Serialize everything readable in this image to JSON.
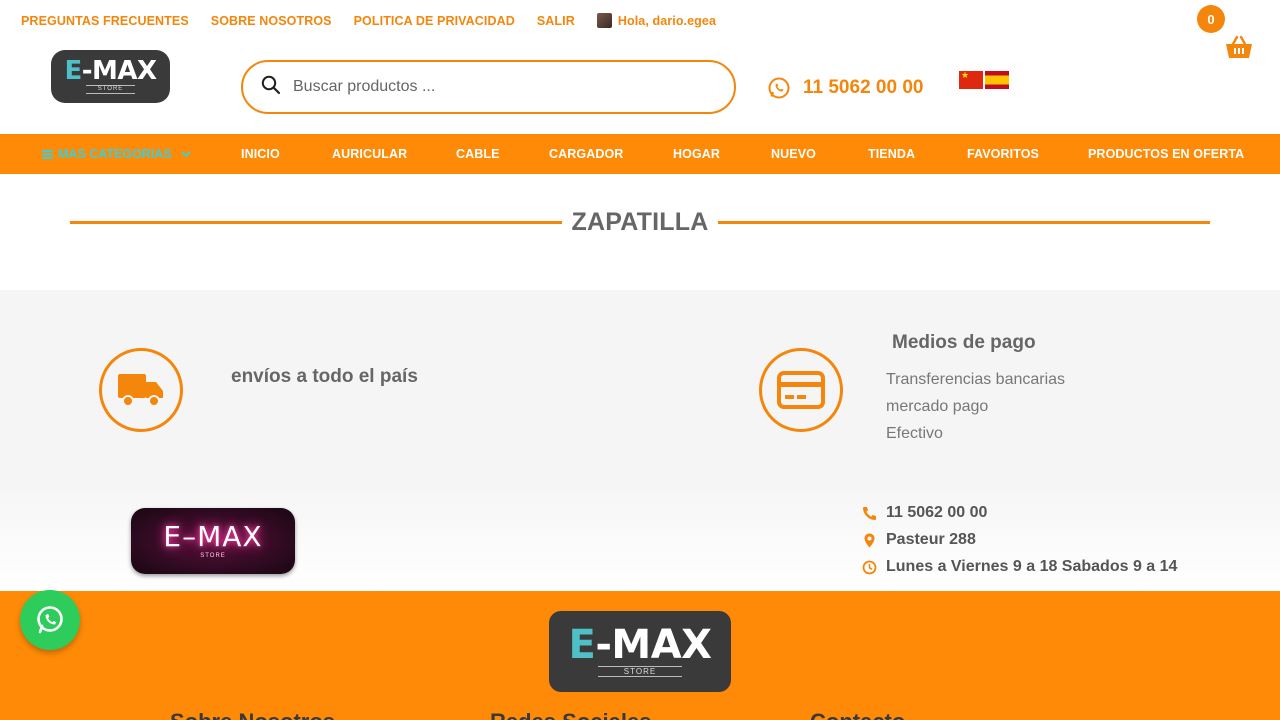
{
  "toplinks": {
    "faq": "PREGUNTAS FRECUENTES",
    "about": "SOBRE NOSOTROS",
    "privacy": "POLITICA DE PRIVACIDAD",
    "logout": "SALIR",
    "greeting": "Hola, dario.egea"
  },
  "logo": {
    "main_e": "E",
    "main_rest": "-MAX",
    "sub": "STORE"
  },
  "search": {
    "placeholder": "Buscar productos ..."
  },
  "phone": {
    "number": "11 5062 00 00"
  },
  "cart": {
    "count": "0"
  },
  "nav": {
    "categories": "MAS CATEGORIAS",
    "items": [
      "INICIO",
      "AURICULAR",
      "CABLE",
      "CARGADOR",
      "HOGAR",
      "NUEVO",
      "TIENDA",
      "FAVORITOS",
      "PRODUCTOS EN OFERTA"
    ]
  },
  "page": {
    "title": "ZAPATILLA"
  },
  "info": {
    "shipping": "envíos a todo el país",
    "payment_title": "Medios de pago",
    "payment_methods": [
      "Transferencias bancarias",
      "mercado pago",
      "Efectivo"
    ]
  },
  "contact": {
    "neon_logo": "E–MAX",
    "neon_sub": "STORE",
    "phone": "11 5062 00 00",
    "address": "Pasteur 288",
    "hours": "Lunes a Viernes 9 a 18 Sabados 9 a 14"
  },
  "footer": {
    "headings": [
      "Sobre Nosotros",
      "Redes Sociales",
      "Contacto"
    ]
  },
  "colors": {
    "accent": "#ff8a07",
    "teal": "#3ccfd6",
    "whatsapp": "#2ecc5b"
  }
}
